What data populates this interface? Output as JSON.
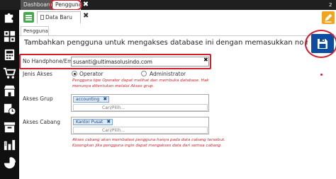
{
  "top_tabs": [
    {
      "label": "Dashboard"
    },
    {
      "label": "Pengguna"
    }
  ],
  "top_close": "✖",
  "notification_count": "2",
  "inner_tab": {
    "label": "Data Baru",
    "close": "✖"
  },
  "section_tab": "Pengguna",
  "page_description": "Tambahkan pengguna untuk mengakses database ini dengan memasukkan no handphone/emailnya",
  "form": {
    "phone_email": {
      "label": "No Handphone/Email",
      "value": "susanti@ultimasolusindo.com",
      "clear": "✖"
    },
    "access_type": {
      "label": "Jenis Akses",
      "options": [
        {
          "label": "Operator",
          "selected": true
        },
        {
          "label": "Administrator",
          "selected": false
        }
      ],
      "help": [
        "Pengguna tipe Operator dapat melihat dan membuka database. Hak",
        "menunya ditentukan melalui Akses grup."
      ]
    },
    "group_access": {
      "label": "Akses Grup",
      "chip": "accounting",
      "chip_remove": "✖",
      "placeholder": "Cari/Pilih..."
    },
    "branch_access": {
      "label": "Akses Cabang",
      "chip": "Kantor Pusat",
      "chip_remove": "✖",
      "placeholder": "Cari/Pilih...",
      "help": [
        "Akses cabang akan membatasi pengguna hanya pada data cabang tersebut.",
        "Kosongkan jika pengguna ingin dapat mengakses data dari semua cabang."
      ]
    }
  },
  "colors": {
    "sidebar": "#101010",
    "save_button": "#0c4da2",
    "menu_button": "#3fae49",
    "annotation": "#d21f2b",
    "pencil_badge": "#f2a51c"
  },
  "icons": [
    "menu-icon",
    "save-icon",
    "pencil-icon",
    "puzzle-icon",
    "grid-icon",
    "calculator-icon",
    "cart-icon",
    "store-icon",
    "clock-icon",
    "archive-icon",
    "chart-icon",
    "pie-icon"
  ]
}
